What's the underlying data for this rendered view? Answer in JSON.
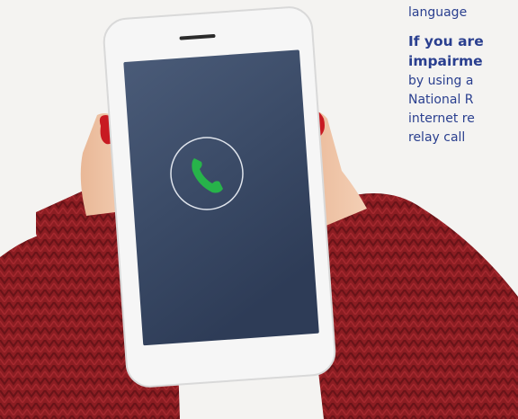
{
  "text_column": {
    "line1": "language",
    "line2": "If you are",
    "line3": "impairme",
    "line4": "by using a",
    "line5": "National R",
    "line6": "internet re",
    "line7": "relay call"
  },
  "phone_icon": "phone-handset-icon",
  "colors": {
    "sweater": "#8c1d22",
    "screen": "#3a4a66",
    "phone_icon": "#27b34a",
    "text": "#2a3f8f",
    "nails": "#c81a22"
  }
}
